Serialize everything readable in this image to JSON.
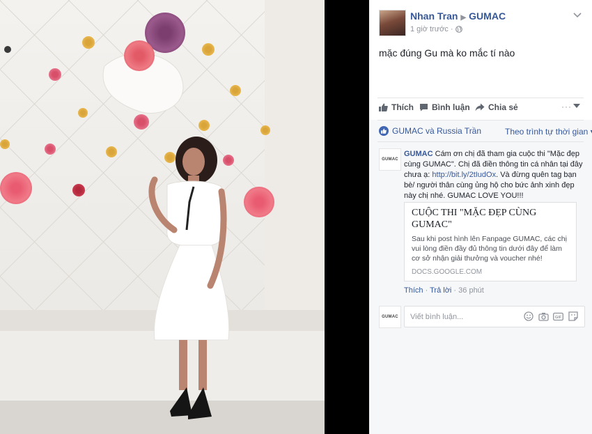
{
  "post": {
    "author": "Nhan Tran",
    "target": "GUMAC",
    "time": "1 giờ trước",
    "text": "mặc đúng Gu mà ko mắc tí nào"
  },
  "actions": {
    "like": "Thích",
    "comment": "Bình luận",
    "share": "Chia sẻ",
    "more": "···"
  },
  "reactions": {
    "names": "GUMAC và Russia Trần",
    "sort": "Theo trình tự thời gian ▾"
  },
  "comment": {
    "avatar_text": "GUMAC",
    "author": "GUMAC",
    "text_1": " Cám ơn chị đã tham gia cuộc thi \"Mặc đẹp cùng GUMAC\". Chị đã điền thông tin cá nhân tại đây chưa ạ: ",
    "link": "http://bit.ly/2tIudOx",
    "text_2": ". Và đừng quên tag bạn bè/ người thân cùng ủng hộ cho bức ảnh xinh đẹp này chị nhé. GUMAC LOVE YOU!!!",
    "card": {
      "title": "CUỘC THI \"MẶC ĐẸP CÙNG GUMAC\"",
      "description": "Sau khi post hình lên Fanpage GUMAC, các chị vui lòng điền đầy đủ thông tin dưới đây để làm cơ sở nhận giải thưởng và voucher nhé!",
      "domain": "DOCS.GOOGLE.COM"
    },
    "like": "Thích",
    "reply": "Trả lời",
    "time": "36 phút"
  },
  "composer": {
    "avatar_text": "GUMAC",
    "placeholder": "Viết bình luận..."
  }
}
